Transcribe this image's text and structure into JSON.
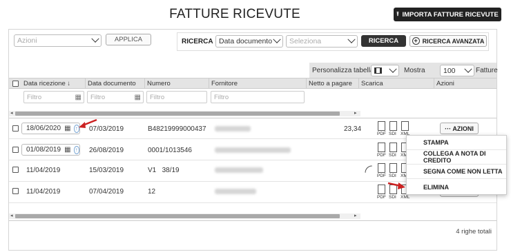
{
  "page": {
    "title": "FATTURE RICEVUTE",
    "import_button": "IMPORTA FATTURE RICEVUTE"
  },
  "toolbar": {
    "actions_placeholder": "Azioni",
    "apply_label": "APPLICA",
    "search_label": "RICERCA",
    "search_field_value": "Data documento",
    "search_value_placeholder": "Seleziona",
    "search_button": "RICERCA",
    "advanced_search_button": "RICERCA AVANZATA"
  },
  "table_controls": {
    "customize_label": "Personalizza tabella",
    "show_label": "Mostra",
    "page_size": "100",
    "suffix_label": "Fatture"
  },
  "table": {
    "columns": [
      "Data ricezione",
      "Data documento",
      "Numero",
      "Fornitore",
      "Netto a pagare",
      "Scarica",
      "Azioni"
    ],
    "sort_indicator": "↓",
    "filter_placeholder": "Filtro",
    "rows": [
      {
        "received": "18/06/2020",
        "doc_date": "07/03/2019",
        "number": "B48219999000437",
        "supplier": "",
        "net": "23,34",
        "has_date_picker": true
      },
      {
        "received": "01/08/2019",
        "doc_date": "26/08/2019",
        "number": "0001/1013546",
        "supplier": "",
        "net": "",
        "has_date_picker": true
      },
      {
        "received": "11/04/2019",
        "doc_date": "15/03/2019",
        "number": "V1   38/19",
        "supplier": "",
        "net": "",
        "has_date_picker": false
      },
      {
        "received": "11/04/2019",
        "doc_date": "07/04/2019",
        "number": "12",
        "supplier": "",
        "net": "",
        "has_date_picker": false
      }
    ],
    "download_labels": [
      "PDF",
      "SDI",
      "XML"
    ],
    "row_action_button": "··· AZIONI",
    "total_rows": "4 righe totali"
  },
  "actions_menu": {
    "items": [
      "STAMPA",
      "COLLEGA A NOTA DI CREDITO",
      "SEGNA COME NON LETTA",
      "ELIMINA"
    ]
  },
  "colors": {
    "dark_button": "#333333",
    "header_bg": "#e4e4e4",
    "annotation_arrow": "#cc2222",
    "info_icon": "#5b8fc7"
  },
  "icons": [
    "upload-icon",
    "chevron-down-icon",
    "plus-circle-icon",
    "calendar-icon",
    "columns-icon",
    "paperclip-icon",
    "pdf-file-icon",
    "sdi-file-icon",
    "xml-file-icon",
    "red-arrow-icon"
  ]
}
